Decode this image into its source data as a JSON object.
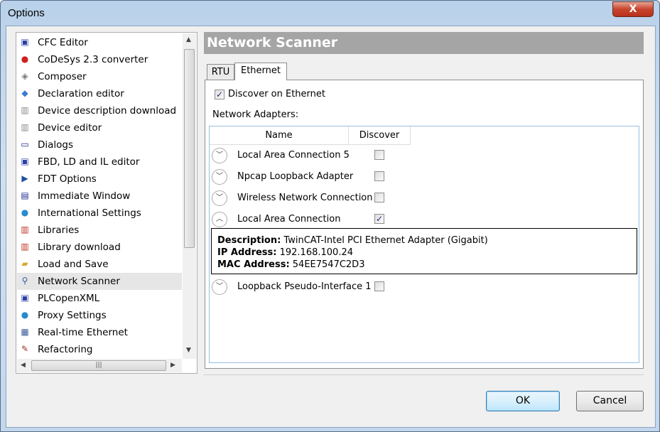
{
  "window": {
    "title": "Options",
    "close_label": "X"
  },
  "sidebar": {
    "items": [
      {
        "label": "CFC Editor",
        "icon": "cfc-editor-icon",
        "glyph": "▣",
        "color": "#2a3ea8"
      },
      {
        "label": "CoDeSys 2.3 converter",
        "icon": "converter-icon",
        "glyph": "●",
        "color": "#d02020"
      },
      {
        "label": "Composer",
        "icon": "composer-icon",
        "glyph": "◈",
        "color": "#777777"
      },
      {
        "label": "Declaration editor",
        "icon": "declaration-editor-icon",
        "glyph": "◆",
        "color": "#3a7ad0"
      },
      {
        "label": "Device description download",
        "icon": "device-icon",
        "glyph": "▥",
        "color": "#8a8a8a"
      },
      {
        "label": "Device editor",
        "icon": "device-icon",
        "glyph": "▥",
        "color": "#8a8a8a"
      },
      {
        "label": "Dialogs",
        "icon": "dialog-icon",
        "glyph": "▭",
        "color": "#1a2a8a"
      },
      {
        "label": "FBD, LD and IL editor",
        "icon": "fbd-editor-icon",
        "glyph": "▣",
        "color": "#2a3ea8"
      },
      {
        "label": "FDT Options",
        "icon": "fdt-icon",
        "glyph": "▶",
        "color": "#1e4fa0"
      },
      {
        "label": "Immediate Window",
        "icon": "immediate-window-icon",
        "glyph": "▤",
        "color": "#1a2a8a"
      },
      {
        "label": "International Settings",
        "icon": "globe-icon",
        "glyph": "●",
        "color": "#2a8ad0"
      },
      {
        "label": "Libraries",
        "icon": "libraries-icon",
        "glyph": "▥",
        "color": "#c03020"
      },
      {
        "label": "Library download",
        "icon": "library-download-icon",
        "glyph": "▥",
        "color": "#c03020"
      },
      {
        "label": "Load and Save",
        "icon": "folder-icon",
        "glyph": "▰",
        "color": "#d8a830"
      },
      {
        "label": "Network Scanner",
        "icon": "magnifier-icon",
        "glyph": "⚲",
        "color": "#3060a0",
        "selected": true
      },
      {
        "label": "PLCopenXML",
        "icon": "plcopen-icon",
        "glyph": "▣",
        "color": "#2a3ea8"
      },
      {
        "label": "Proxy Settings",
        "icon": "proxy-icon",
        "glyph": "●",
        "color": "#2a8ad0"
      },
      {
        "label": "Real-time Ethernet",
        "icon": "ethernet-icon",
        "glyph": "▦",
        "color": "#3a5a9a"
      },
      {
        "label": "Refactoring",
        "icon": "refactoring-icon",
        "glyph": "✎",
        "color": "#a03020"
      }
    ]
  },
  "main": {
    "header": "Network Scanner",
    "tabs": [
      {
        "label": "RTU"
      },
      {
        "label": "Ethernet",
        "active": true
      }
    ],
    "discover_label": "Discover on Ethernet",
    "discover_checked": true,
    "adapters_label": "Network Adapters:",
    "columns": [
      "Name",
      "Discover"
    ],
    "adapters": [
      {
        "name": "Local Area Connection 5",
        "discover": false,
        "expanded": false
      },
      {
        "name": "Npcap Loopback Adapter",
        "discover": false,
        "expanded": false
      },
      {
        "name": "Wireless Network Connection",
        "discover": false,
        "expanded": false
      },
      {
        "name": "Local Area Connection",
        "discover": true,
        "expanded": true
      },
      {
        "name": "Loopback Pseudo-Interface 1",
        "discover": false,
        "expanded": false
      }
    ],
    "detail": {
      "description_label": "Description:",
      "description": "TwinCAT-Intel PCI Ethernet Adapter (Gigabit)",
      "ip_label": "IP Address:",
      "ip": "192.168.100.24",
      "mac_label": "MAC Address:",
      "mac": "54EE7547C2D3"
    }
  },
  "buttons": {
    "ok": "OK",
    "cancel": "Cancel"
  }
}
